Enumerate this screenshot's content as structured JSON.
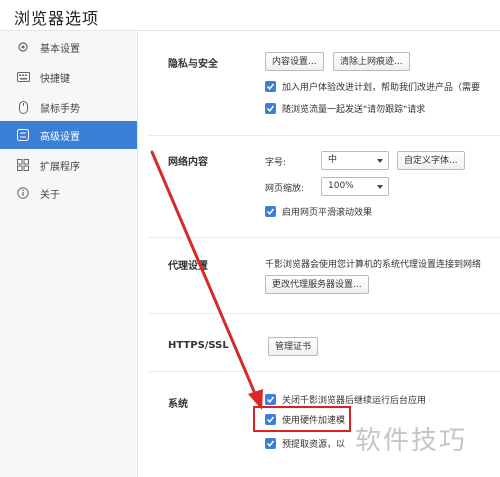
{
  "window": {
    "title": "浏览器选项"
  },
  "sidebar": {
    "items": [
      {
        "label": "基本设置",
        "icon": "gear-icon"
      },
      {
        "label": "快捷键",
        "icon": "keyboard-icon"
      },
      {
        "label": "鼠标手势",
        "icon": "mouse-icon"
      },
      {
        "label": "高级设置",
        "icon": "advanced-settings-icon",
        "active": true
      },
      {
        "label": "扩展程序",
        "icon": "extensions-icon"
      },
      {
        "label": "关于",
        "icon": "info-icon"
      }
    ]
  },
  "privacy": {
    "title": "隐私与安全",
    "content_settings_btn": "内容设置...",
    "clear_history_btn": "清除上网痕迹...",
    "ux_program": "加入用户体验改进计划，帮助我们改进产品（需要",
    "do_not_track": "随浏览流量一起发送\"请勿跟踪\"请求"
  },
  "web_content": {
    "title": "网络内容",
    "font_size_label": "字号:",
    "font_size_value": "中",
    "custom_font_btn": "自定义字体...",
    "zoom_label": "网页缩放:",
    "zoom_value": "100%",
    "smooth_scroll": "启用网页平滑滚动效果"
  },
  "proxy": {
    "title": "代理设置",
    "desc": "千影浏览器会使用您计算机的系统代理设置连接到网络",
    "change_btn": "更改代理服务器设置..."
  },
  "https": {
    "title": "HTTPS/SSL",
    "manage_cert_btn": "管理证书"
  },
  "system": {
    "title": "系统",
    "close_bg": "关闭千影浏览器后继续运行后台应用",
    "hw_accel": "使用硬件加速模",
    "prefetch": "预提取资源，以"
  },
  "watermark": "软件技巧",
  "colors": {
    "accent": "#3b7fd8",
    "arrow": "#d42a2a"
  }
}
